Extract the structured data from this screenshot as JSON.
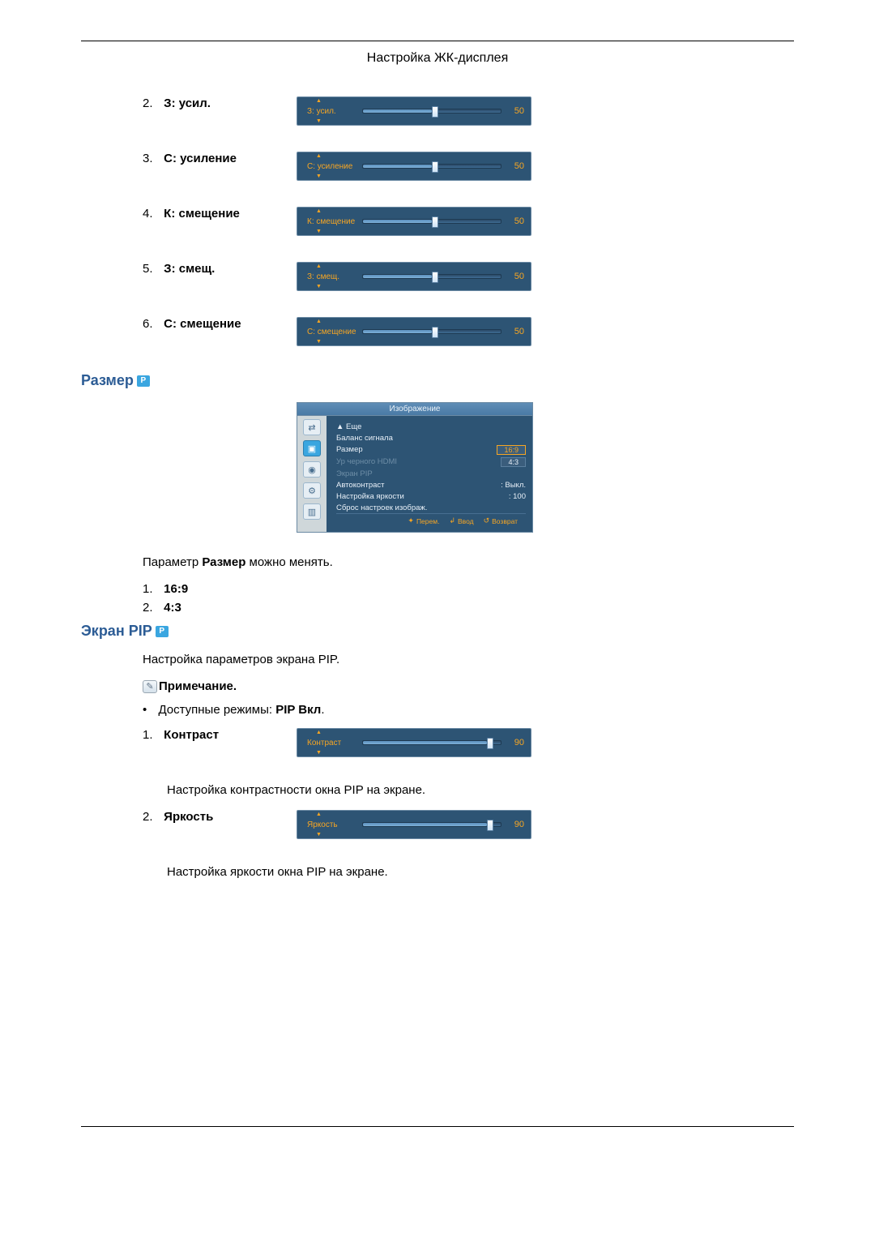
{
  "page_title": "Настройка ЖК-дисплея",
  "sliders": [
    {
      "num": "2.",
      "label": "З: усил.",
      "osd_label": "З: усил.",
      "value": "50",
      "pct": 50
    },
    {
      "num": "3.",
      "label": "С: усиление",
      "osd_label": "С: усиление",
      "value": "50",
      "pct": 50
    },
    {
      "num": "4.",
      "label": "К: смещение",
      "osd_label": "К: смещение",
      "value": "50",
      "pct": 50
    },
    {
      "num": "5.",
      "label": "З: смещ.",
      "osd_label": "З: смещ.",
      "value": "50",
      "pct": 50
    },
    {
      "num": "6.",
      "label": "С: смещение",
      "osd_label": "С: смещение",
      "value": "50",
      "pct": 50
    }
  ],
  "size_section": {
    "heading": "Размер",
    "p_icon": "P",
    "osd_title": "Изображение",
    "osd_items": [
      {
        "label": "▲ Еще",
        "value": "",
        "dim": false
      },
      {
        "label": "Баланс сигнала",
        "value": "",
        "dim": false
      },
      {
        "label": "Размер",
        "value": "16:9",
        "dim": false,
        "sel": true
      },
      {
        "label": "Ур черного HDMI",
        "value": "4:3",
        "dim": true,
        "box": true
      },
      {
        "label": "Экран PIP",
        "value": "",
        "dim": true
      },
      {
        "label": "Автоконтраст",
        "value": ": Выкл.",
        "dim": false
      },
      {
        "label": "Настройка яркости",
        "value": ": 100",
        "dim": false
      },
      {
        "label": "Сброс настроек изображ.",
        "value": "",
        "dim": false
      }
    ],
    "osd_footer": {
      "move": "Перем.",
      "enter": "Ввод",
      "return": "Возврат"
    },
    "text_parameter": "Параметр ",
    "text_bold": "Размер",
    "text_suffix": " можно менять.",
    "options": [
      {
        "num": "1.",
        "label": "16:9"
      },
      {
        "num": "2.",
        "label": "4:3"
      }
    ]
  },
  "pip_section": {
    "heading": "Экран PIP",
    "p_icon": "P",
    "intro": "Настройка параметров экрана PIP.",
    "note_label": "Примечание.",
    "bullet_prefix": "Доступные режимы: ",
    "bullet_bold": "PIP Вкл",
    "bullet_suffix": ".",
    "items": [
      {
        "num": "1.",
        "label": "Контраст",
        "osd_label": "Контраст",
        "value": "90",
        "pct": 90,
        "desc": "Настройка контрастности окна PIP на экране."
      },
      {
        "num": "2.",
        "label": "Яркость",
        "osd_label": "Яркость",
        "value": "90",
        "pct": 90,
        "desc": "Настройка яркости окна PIP на экране."
      }
    ]
  }
}
